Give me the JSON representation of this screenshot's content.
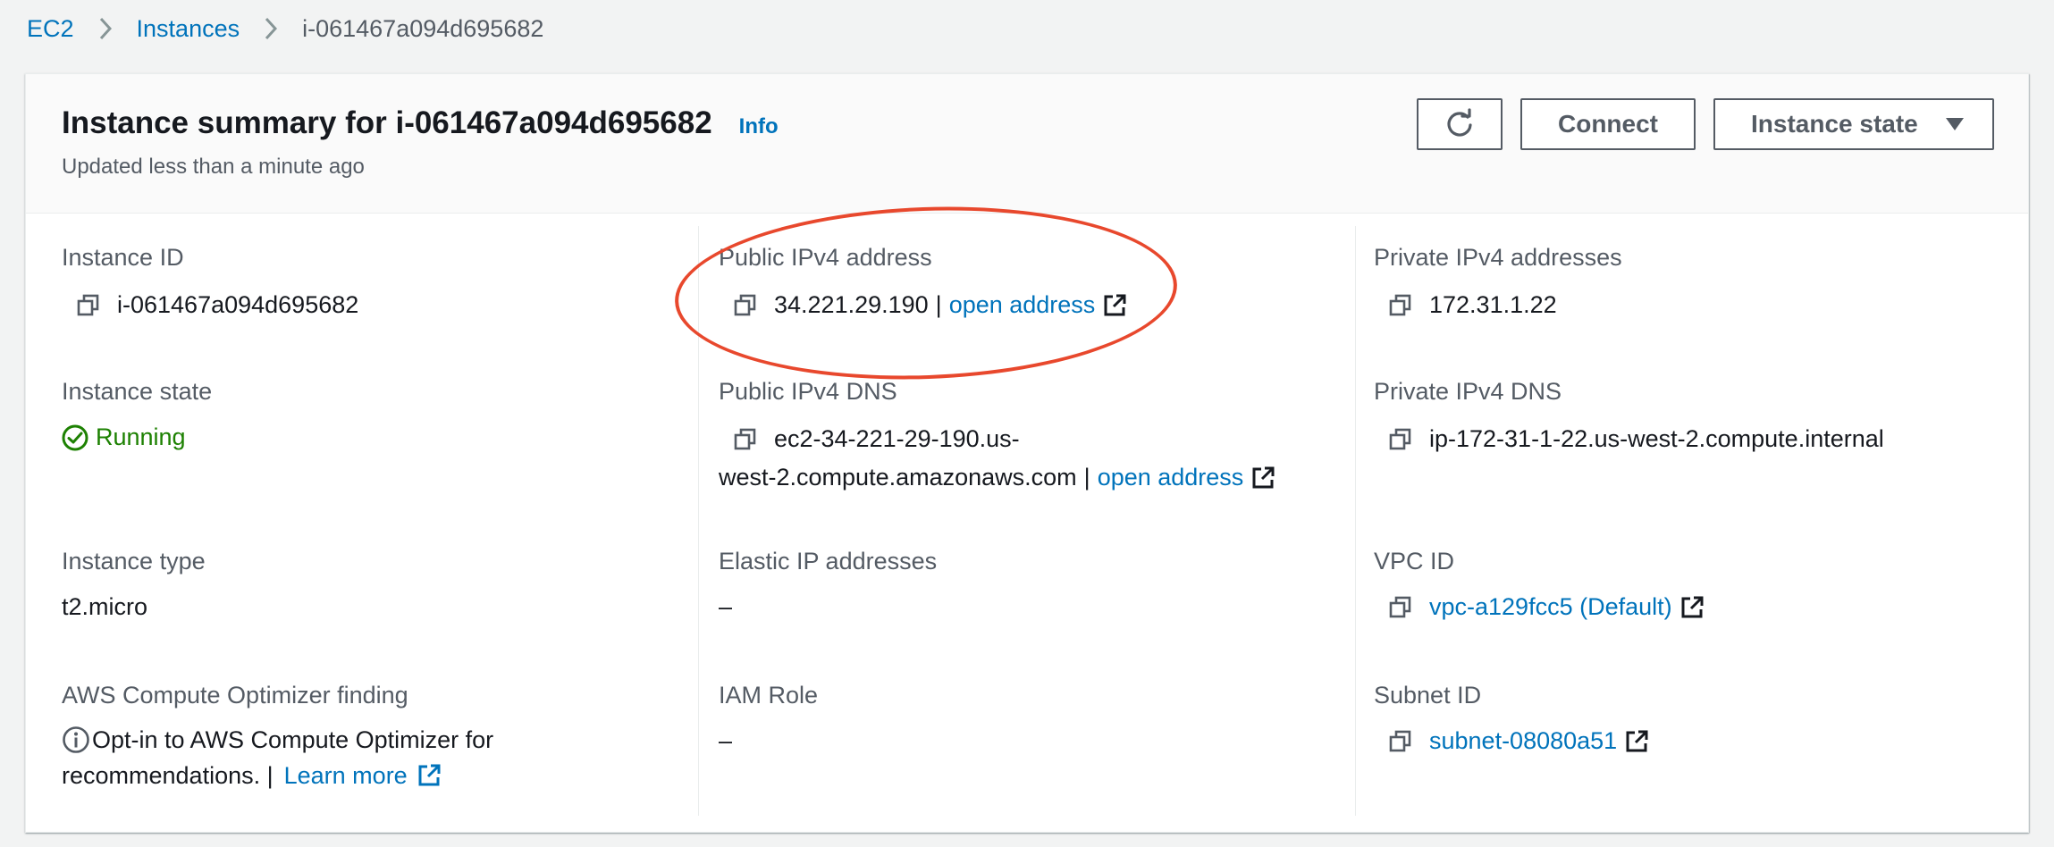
{
  "breadcrumb": {
    "service": "EC2",
    "section": "Instances",
    "current": "i-061467a094d695682"
  },
  "header": {
    "title": "Instance summary for i-061467a094d695682",
    "info": "Info",
    "subtitle": "Updated less than a minute ago",
    "connect_label": "Connect",
    "instance_state_label": "Instance state"
  },
  "col1": {
    "instance_id": {
      "label": "Instance ID",
      "value": "i-061467a094d695682"
    },
    "instance_state": {
      "label": "Instance state",
      "value": "Running"
    },
    "instance_type": {
      "label": "Instance type",
      "value": "t2.micro"
    },
    "optimizer": {
      "label": "AWS Compute Optimizer finding",
      "text_line1": "Opt-in to AWS Compute Optimizer for",
      "text_line2": "recommendations. |",
      "link": "Learn more"
    }
  },
  "col2": {
    "public_ipv4": {
      "label": "Public IPv4 address",
      "value": "34.221.29.190",
      "sep": "|",
      "link": "open address"
    },
    "public_dns": {
      "label": "Public IPv4 DNS",
      "value_line1": "ec2-34-221-29-190.us-",
      "value_line2": "west-2.compute.amazonaws.com",
      "sep": "|",
      "link": "open address"
    },
    "elastic_ip": {
      "label": "Elastic IP addresses",
      "value": "–"
    },
    "iam_role": {
      "label": "IAM Role",
      "value": "–"
    }
  },
  "col3": {
    "private_ipv4": {
      "label": "Private IPv4 addresses",
      "value": "172.31.1.22"
    },
    "private_dns": {
      "label": "Private IPv4 DNS",
      "value": "ip-172-31-1-22.us-west-2.compute.internal"
    },
    "vpc": {
      "label": "VPC ID",
      "value": "vpc-a129fcc5 (Default)"
    },
    "subnet": {
      "label": "Subnet ID",
      "value": "subnet-08080a51"
    }
  },
  "colors": {
    "link": "#0073bb",
    "running": "#1d8102",
    "annotation": "#e8482d"
  },
  "icons": [
    "copy-icon",
    "external-link-icon",
    "refresh-icon",
    "caret-down-icon",
    "check-circle-icon",
    "info-circle-icon",
    "chevron-right-icon"
  ]
}
